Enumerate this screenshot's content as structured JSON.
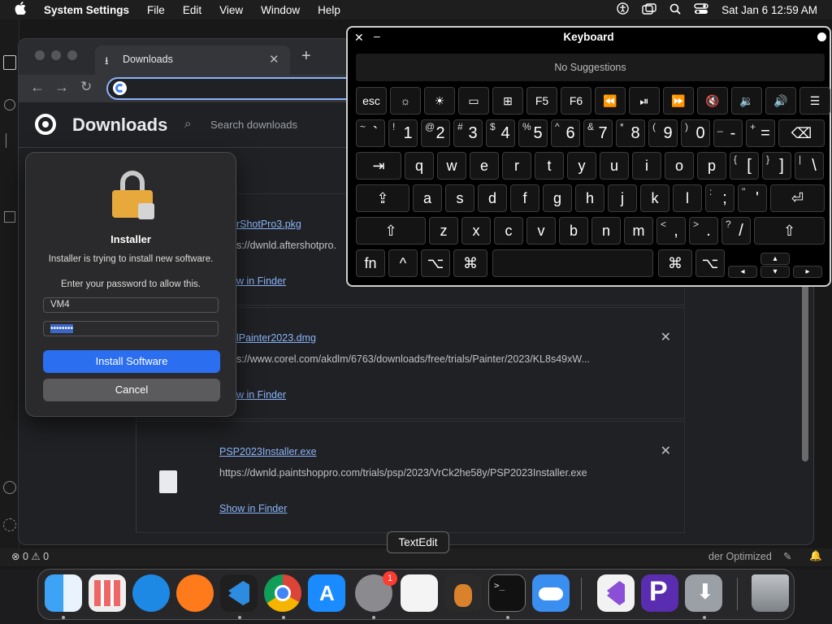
{
  "menubar": {
    "app_name": "System Settings",
    "items": [
      "File",
      "Edit",
      "View",
      "Window",
      "Help"
    ],
    "clock": "Sat Jan 6  12:59 AM"
  },
  "chrome": {
    "tab_title": "Downloads",
    "new_tab": "+",
    "omnibox_value": "",
    "page_title": "Downloads",
    "search_placeholder": "Search downloads",
    "downloads": [
      {
        "name": "AfterShotPro3.pkg",
        "visible_name": "erShotPro3.pkg",
        "url": "https://dwnld.aftershotpro.",
        "visible_url": "os://dwnld.aftershotpro.",
        "show": "Show in Finder",
        "visible_show": "ow in Finder"
      },
      {
        "name": "CorelPainter2023.dmg",
        "visible_name": "elPainter2023.dmg",
        "url": "https://www.corel.com/akdlm/6763/downloads/free/trials/Painter/2023/KL8s49xW...",
        "visible_url": "os://www.corel.com/akdlm/6763/downloads/free/trials/Painter/2023/KL8s49xW...",
        "show": "Show in Finder",
        "visible_show": "ow in Finder"
      },
      {
        "name": "PSP2023Installer.exe",
        "url": "https://dwnld.paintshoppro.com/trials/psp/2023/VrCk2he58y/PSP2023Installer.exe",
        "show": "Show in Finder"
      }
    ]
  },
  "installer": {
    "title": "Installer",
    "message": "Installer is trying to install new software.",
    "prompt": "Enter your password to allow this.",
    "username": "VM4",
    "password_mask": "••••••••",
    "install_button": "Install Software",
    "cancel_button": "Cancel"
  },
  "keyboard": {
    "title": "Keyboard",
    "suggestions": "No Suggestions",
    "fkeys": [
      "esc",
      "F5",
      "F6"
    ],
    "row1": [
      [
        "~",
        "`"
      ],
      [
        "!",
        "1"
      ],
      [
        "@",
        "2"
      ],
      [
        "#",
        "3"
      ],
      [
        "$",
        "4"
      ],
      [
        "%",
        "5"
      ],
      [
        "^",
        "6"
      ],
      [
        "&",
        "7"
      ],
      [
        "*",
        "8"
      ],
      [
        "(",
        "9"
      ],
      [
        ")",
        "0"
      ],
      [
        "_",
        "-"
      ],
      [
        "+",
        "="
      ]
    ],
    "row2": [
      "q",
      "w",
      "e",
      "r",
      "t",
      "y",
      "u",
      "i",
      "o",
      "p"
    ],
    "row2_brackets": [
      [
        "{",
        "["
      ],
      [
        "}",
        "]"
      ],
      [
        "|",
        "\\"
      ]
    ],
    "row3": [
      "a",
      "s",
      "d",
      "f",
      "g",
      "h",
      "j",
      "k",
      "l"
    ],
    "row3_punct": [
      [
        ":",
        ";"
      ],
      [
        "\"",
        "'"
      ]
    ],
    "row4": [
      "z",
      "x",
      "c",
      "v",
      "b",
      "n",
      "m"
    ],
    "row4_punct": [
      [
        "<",
        ","
      ],
      [
        ">",
        "."
      ],
      [
        "?",
        "/"
      ]
    ],
    "fn": "fn",
    "ctrl": "^",
    "opt": "⌥",
    "cmd": "⌘"
  },
  "statusbar": {
    "errors": "0",
    "warnings": "0",
    "right_text": "der Optimized"
  },
  "dock": {
    "tooltip": "TextEdit",
    "badge": "1"
  }
}
